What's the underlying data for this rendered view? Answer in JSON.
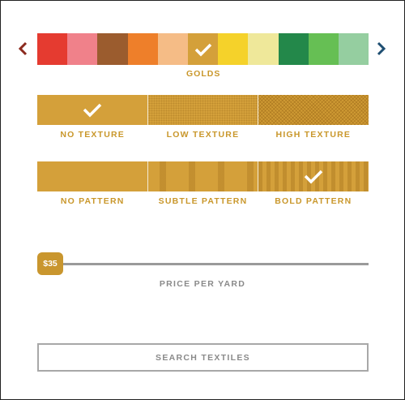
{
  "colors": {
    "selected_label": "GOLDS",
    "prev_icon": "chevron-left-icon",
    "next_icon": "chevron-right-icon",
    "prev_color": "#8b2a1e",
    "next_color": "#1f4f72",
    "swatches": [
      {
        "hex": "#e53b30",
        "selected": false
      },
      {
        "hex": "#f0818a",
        "selected": false
      },
      {
        "hex": "#9b5c2e",
        "selected": false
      },
      {
        "hex": "#ee7f2a",
        "selected": false
      },
      {
        "hex": "#f5bc86",
        "selected": false
      },
      {
        "hex": "#d4a03a",
        "selected": true
      },
      {
        "hex": "#f5d22a",
        "selected": false
      },
      {
        "hex": "#efe89a",
        "selected": false
      },
      {
        "hex": "#23884a",
        "selected": false
      },
      {
        "hex": "#66bf54",
        "selected": false
      },
      {
        "hex": "#95cea0",
        "selected": false
      }
    ]
  },
  "texture": {
    "options": [
      {
        "label": "NO TEXTURE",
        "selected": true
      },
      {
        "label": "LOW TEXTURE",
        "selected": false
      },
      {
        "label": "HIGH TEXTURE",
        "selected": false
      }
    ]
  },
  "pattern": {
    "options": [
      {
        "label": "NO PATTERN",
        "selected": false
      },
      {
        "label": "SUBTLE PATTERN",
        "selected": false
      },
      {
        "label": "BOLD PATTERN",
        "selected": true
      }
    ]
  },
  "price": {
    "value_label": "$35",
    "label": "PRICE PER YARD",
    "slider_fraction": 0.0
  },
  "search": {
    "button_label": "SEARCH TEXTILES"
  },
  "accent_color": "#d4a03a",
  "check_icon": "checkmark-icon"
}
